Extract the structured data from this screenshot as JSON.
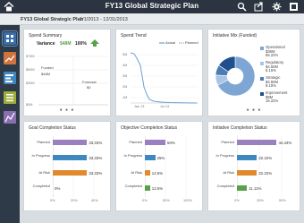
{
  "app": {
    "title": "FY13 Global Strategic Plan",
    "plan_name": "FY13 Global Strategic Plan",
    "date_range": "1/1/2013 - 12/31/2013",
    "colors": {
      "titlebar": "#2b3440",
      "sidebar": "#2e3a47",
      "bar": "#9b80bf",
      "accent_green": "#5aa04a"
    },
    "icons": [
      "home-icon",
      "search-icon",
      "share-icon",
      "settings-icon",
      "more-icon"
    ]
  },
  "sidebar": {
    "items": [
      {
        "name": "grid-view",
        "color": "#3a6fa8"
      },
      {
        "name": "trend-view",
        "color": "#d0733e"
      },
      {
        "name": "bars-view",
        "color": "#3f87bf"
      },
      {
        "name": "list-view",
        "color": "#9fae3a"
      },
      {
        "name": "chart-view",
        "color": "#8a6fb0"
      }
    ]
  },
  "spend_summary": {
    "title": "Spend Summary",
    "variance_label": "Variance",
    "variance_value": "$48M",
    "variance_pct": "100%",
    "funded_label": "Funded",
    "funded_value": "$48M",
    "forecast_label": "Forecast",
    "forecast_value": "$0",
    "y_ticks": [
      "$70M",
      "$50M",
      "$30M",
      "$0M"
    ]
  },
  "spend_trend": {
    "title": "Spend Trend",
    "legend": [
      "Actual",
      "Planned"
    ],
    "y_ticks": [
      "5M",
      "4M",
      "3M",
      "2M",
      "1M"
    ],
    "x_ticks": [
      "Jan 13",
      "Jul 13"
    ]
  },
  "initiative_mix": {
    "title": "Initiative Mix (Funded)",
    "chart_data": {
      "type": "pie",
      "title": "Initiative Mix (Funded)",
      "slices": [
        {
          "name": "Operational",
          "amount": "$36M",
          "percent": 65.22,
          "color": "#7ea6d4"
        },
        {
          "name": "Regulatory",
          "amount": "$4.50M",
          "percent": 8.15,
          "color": "#a9c4e4"
        },
        {
          "name": "Strategic",
          "amount": "$4.50M",
          "percent": 8.15,
          "color": "#4d7cb4"
        },
        {
          "name": "Improvement",
          "amount": "$8M",
          "percent": 15.22,
          "color": "#1f4f8c"
        }
      ]
    },
    "legend": [
      {
        "line1": "Operational",
        "line2": "$36M",
        "line3": "65.22%",
        "color": "#7ea6d4"
      },
      {
        "line1": "Regulatory",
        "line2": "$4.50M",
        "line3": "8.15%",
        "color": "#a9c4e4"
      },
      {
        "line1": "Strategic",
        "line2": "$4.50M",
        "line3": "8.15%",
        "color": "#4d7cb4"
      },
      {
        "line1": "Improvement",
        "line2": "$8M",
        "line3": "15.22%",
        "color": "#1f4f8c"
      }
    ]
  },
  "goal_status": {
    "title": "Goal Completion Status",
    "chart_data": {
      "type": "bar",
      "orientation": "horizontal",
      "categories": [
        "Planned",
        "In Progress",
        "At Risk",
        "Completed"
      ],
      "values": [
        33.33,
        33.33,
        33.33,
        0
      ],
      "labels": [
        "33.33%",
        "33.33%",
        "33.33%",
        "0%"
      ],
      "colors": [
        "#9b80bf",
        "#3f87bf",
        "#e08a2e",
        "#5aa04a"
      ],
      "xlim": [
        0,
        40
      ],
      "x_ticks": [
        "0%",
        "20%",
        "40%"
      ]
    }
  },
  "objective_status": {
    "title": "Objective Completion Status",
    "chart_data": {
      "type": "bar",
      "orientation": "horizontal",
      "categories": [
        "Planned",
        "In Progress",
        "At Risk",
        "Completed"
      ],
      "values": [
        50,
        25,
        12.5,
        12.5
      ],
      "labels": [
        "50%",
        "25%",
        "12.5%",
        "12.5%"
      ],
      "colors": [
        "#9b80bf",
        "#3f87bf",
        "#e08a2e",
        "#5aa04a"
      ],
      "xlim": [
        0,
        100
      ],
      "x_ticks": [
        "0%",
        "50%",
        "100%"
      ]
    }
  },
  "initiative_status": {
    "title": "Initiative Completion Status",
    "chart_data": {
      "type": "bar",
      "orientation": "horizontal",
      "categories": [
        "Planned",
        "In Progress",
        "At Risk",
        "Completed"
      ],
      "values": [
        44.44,
        22.22,
        22.22,
        11.11
      ],
      "labels": [
        "44.44%",
        "22.22%",
        "22.22%",
        "11.11%"
      ],
      "colors": [
        "#9b80bf",
        "#3f87bf",
        "#e08a2e",
        "#5aa04a"
      ],
      "xlim": [
        0,
        50
      ],
      "x_ticks": [
        "0%",
        "25%",
        "50%"
      ]
    }
  }
}
